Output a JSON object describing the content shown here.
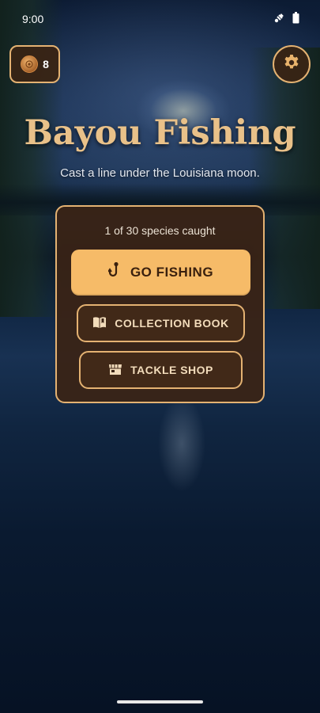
{
  "status_bar": {
    "time": "9:00",
    "icons": [
      "signal-icon",
      "battery-icon"
    ]
  },
  "coins": {
    "icon": "coin-icon",
    "count": "8"
  },
  "settings": {
    "icon": "gear-icon"
  },
  "header": {
    "title": "Bayou Fishing",
    "subtitle": "Cast a line under the Louisiana moon."
  },
  "menu": {
    "progress_text": "1 of 30 species caught",
    "go_fishing": {
      "label": "GO FISHING",
      "icon": "fishhook-icon"
    },
    "collection_book": {
      "label": "COLLECTION BOOK",
      "icon": "book-icon"
    },
    "tackle_shop": {
      "label": "TACKLE SHOP",
      "icon": "shop-icon"
    }
  },
  "colors": {
    "accent": "#e4b272",
    "primary_button": "#f6bb68",
    "card_bg": "#3a2416",
    "title": "#e9c189"
  }
}
